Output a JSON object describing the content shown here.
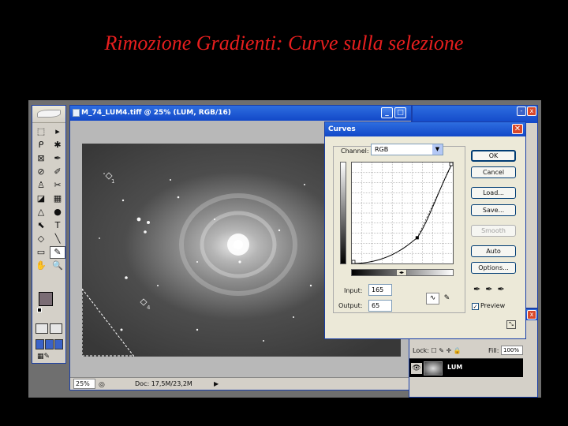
{
  "slide": {
    "title": "Rimozione Gradienti: Curve sulla selezione"
  },
  "toolbox": {
    "tools": [
      "⬚",
      "▸",
      "ᑭ",
      "✱",
      "⊠",
      "✒",
      "⊘",
      "✐",
      "♙",
      "✂",
      "◪",
      "▦",
      "△",
      "●",
      "⬉",
      "T",
      "◇",
      "╲",
      "▭",
      "✎",
      "✋",
      "🔍"
    ]
  },
  "image_window": {
    "title": "M_74_LUM4.tiff @ 25% (LUM, RGB/16)",
    "zoom": "25%",
    "doc_info": "Doc: 17,5M/23,2M",
    "minimize_label": "_",
    "maximize_label": "□",
    "star_labels": [
      "1",
      "4"
    ]
  },
  "curves": {
    "title": "Curves",
    "channel_label": "Channel:",
    "channel_value": "RGB",
    "input_label": "Input:",
    "input_value": "165",
    "output_label": "Output:",
    "output_value": "65",
    "buttons": {
      "ok": "OK",
      "cancel": "Cancel",
      "load": "Load...",
      "save": "Save...",
      "smooth": "Smooth",
      "auto": "Auto",
      "options": "Options..."
    },
    "preview_label": "Preview",
    "preview_checked": true,
    "curve_point": {
      "input": 165,
      "output": 65
    }
  },
  "layers": {
    "lock_label": "Lock:",
    "fill_label": "Fill:",
    "fill_value": "100%",
    "layer_name": "LUM"
  }
}
